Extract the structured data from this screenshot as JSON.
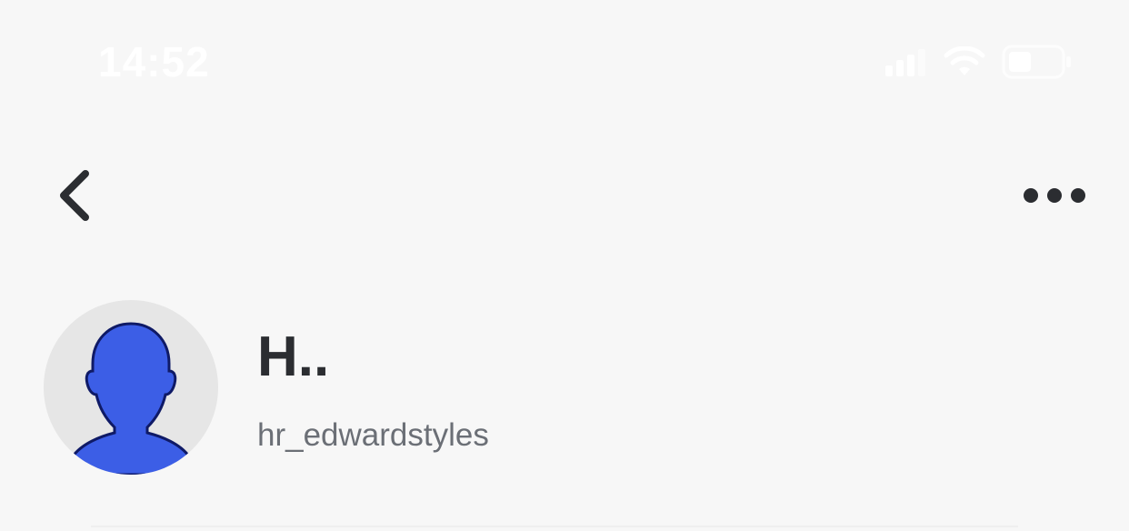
{
  "status_bar": {
    "time": "14:52",
    "icons": [
      "cellular-signal-icon",
      "wifi-icon",
      "battery-icon"
    ]
  },
  "nav": {
    "back_icon": "chevron-left-icon",
    "more_icon": "ellipsis-icon"
  },
  "profile": {
    "display_name": "H..",
    "username": "hr_edwardstyles",
    "avatar_icon": "person-silhouette-icon",
    "avatar_color": "#3c5ee6",
    "avatar_background": "#e6e6e6"
  },
  "colors": {
    "background": "#f7f7f7",
    "primary_text": "#2b2d31",
    "secondary_text": "#6b6f76"
  }
}
